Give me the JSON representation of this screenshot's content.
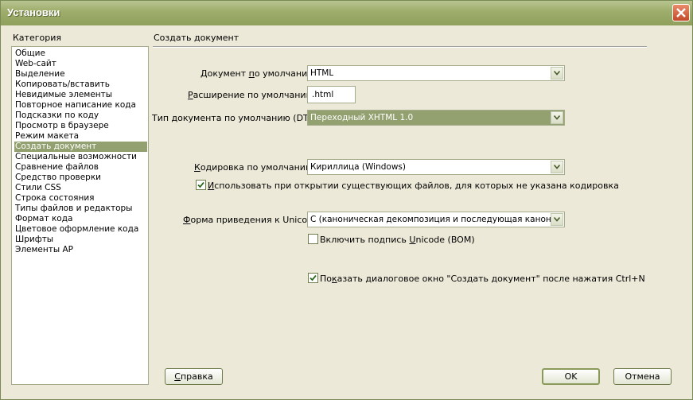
{
  "window": {
    "title": "Установки"
  },
  "category": {
    "header": "Категория",
    "items": [
      "Общие",
      "Web-сайт",
      "Выделение",
      "Копировать/вставить",
      "Невидимые элементы",
      "Повторное написание кода",
      "Подсказки по коду",
      "Просмотр в браузере",
      "Режим макета",
      "Создать документ",
      "Специальные возможности",
      "Сравнение файлов",
      "Средство проверки",
      "Стили CSS",
      "Строка состояния",
      "Типы файлов и редакторы",
      "Формат кода",
      "Цветовое оформление кода",
      "Шрифты",
      "Элементы AP"
    ],
    "selected": "Создать документ"
  },
  "panel": {
    "title": "Создать документ",
    "default_doc": {
      "label_pre": "Документ ",
      "label_u": "п",
      "label_post": "о умолчанию:",
      "value": "HTML"
    },
    "extension": {
      "label_u": "Р",
      "label_post": "асширение по умолчанию:",
      "value": ".html"
    },
    "doctype": {
      "label": "Тип документа по умолчанию (DTD):",
      "value": "Переходный XHTML 1.0"
    },
    "encoding": {
      "label_u": "К",
      "label_post": "одировка по умолчанию:",
      "value": "Кириллица (Windows)"
    },
    "use_encoding": {
      "label_u": "И",
      "label_post": "спользовать при открытии существующих файлов, для которых не указана кодировка",
      "checked": true
    },
    "unicode_form": {
      "label_u": "Ф",
      "label_post": "орма приведения к Unicode:",
      "value": "C (каноническая декомпозиция и последующая каноничес"
    },
    "bom": {
      "label_pre": "Включить подпись ",
      "label_u": "U",
      "label_post": "nicode (BOM)",
      "checked": false
    },
    "show_dialog": {
      "label_pre": "По",
      "label_u": "к",
      "label_post": "азать диалоговое окно \"Создать документ\" после нажатия Ctrl+N",
      "checked": true
    }
  },
  "buttons": {
    "help_u": "С",
    "help_post": "правка",
    "ok": "OK",
    "cancel": "Отмена"
  }
}
